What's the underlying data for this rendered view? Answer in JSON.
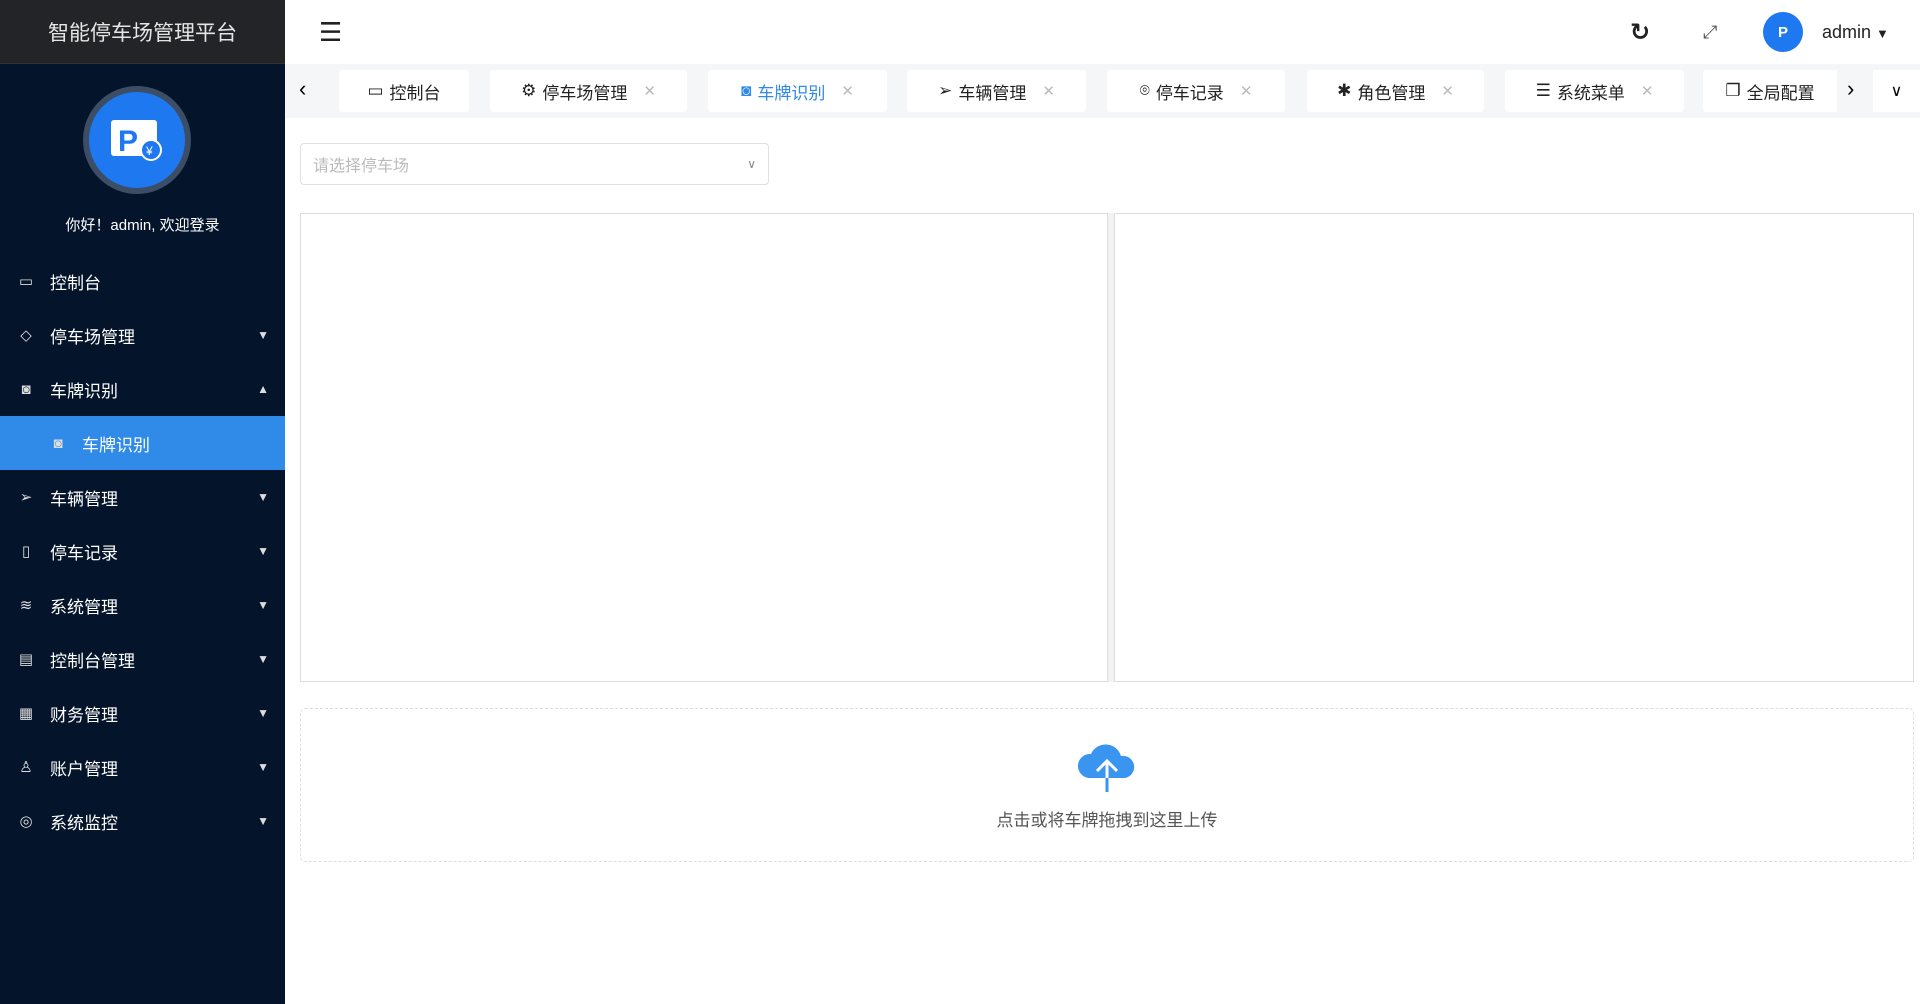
{
  "app": {
    "title": "智能停车场管理平台",
    "greeting": "你好！admin, 欢迎登录"
  },
  "sidebar": {
    "items": [
      {
        "label": "控制台",
        "icon": "monitor-icon"
      },
      {
        "label": "停车场管理",
        "icon": "diamond-icon"
      },
      {
        "label": "车牌识别",
        "icon": "camera-icon",
        "expanded": true
      },
      {
        "label": "车牌识别",
        "icon": "camera-icon",
        "active": true
      },
      {
        "label": "车辆管理",
        "icon": "send-icon"
      },
      {
        "label": "停车记录",
        "icon": "note-icon"
      },
      {
        "label": "系统管理",
        "icon": "layers-icon"
      },
      {
        "label": "控制台管理",
        "icon": "clipboard-icon"
      },
      {
        "label": "财务管理",
        "icon": "apps-icon"
      },
      {
        "label": "账户管理",
        "icon": "user-icon"
      },
      {
        "label": "系统监控",
        "icon": "camera-icon"
      }
    ]
  },
  "header": {
    "user": "admin"
  },
  "tabs": [
    {
      "label": "控制台",
      "icon": "monitor-icon"
    },
    {
      "label": "停车场管理",
      "icon": "gear-icon"
    },
    {
      "label": "车牌识别",
      "icon": "camera-icon"
    },
    {
      "label": "车辆管理",
      "icon": "send-icon"
    },
    {
      "label": "停车记录",
      "icon": "location-icon"
    },
    {
      "label": "角色管理",
      "icon": "palm-icon"
    },
    {
      "label": "系统菜单",
      "icon": "menu-icon"
    },
    {
      "label": "全局配置",
      "icon": "copy-icon"
    }
  ],
  "main": {
    "select_placeholder": "请选择停车场",
    "upload_text": "点击或将车牌拖拽到这里上传"
  },
  "colors": {
    "accent": "#2f8ae8",
    "sidebar": "#03142b"
  }
}
